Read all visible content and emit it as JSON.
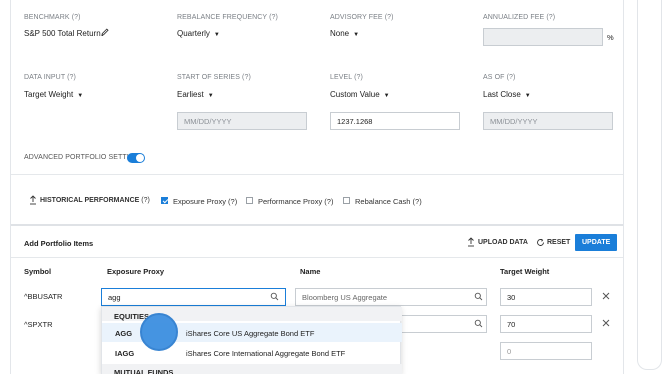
{
  "settings": {
    "benchmark": {
      "label": "BENCHMARK",
      "value": "S&P 500 Total Return"
    },
    "rebalance_frequency": {
      "label": "REBALANCE FREQUENCY",
      "value": "Quarterly"
    },
    "advisory_fee": {
      "label": "ADVISORY FEE",
      "value": "None"
    },
    "annualized_fee": {
      "label": "ANNUALIZED FEE",
      "suffix": "%"
    },
    "data_input": {
      "label": "DATA INPUT",
      "value": "Target Weight"
    },
    "start_of_series": {
      "label": "START OF SERIES",
      "value": "Earliest",
      "date_placeholder": "MM/DD/YYYY"
    },
    "level": {
      "label": "LEVEL",
      "value": "Custom Value",
      "input_value": "1237.1268"
    },
    "as_of": {
      "label": "AS OF",
      "value": "Last Close",
      "date_placeholder": "MM/DD/YYYY"
    },
    "help_mark": "(?)"
  },
  "advanced": {
    "label": "ADVANCED PORTFOLIO SETTINGS",
    "enabled": true
  },
  "options_bar": {
    "historical_performance": "HISTORICAL PERFORMANCE",
    "help_mark": "(?)",
    "exposure_proxy": {
      "label": "Exposure Proxy (?)",
      "checked": true
    },
    "performance_proxy": {
      "label": "Performance Proxy (?)",
      "checked": false
    },
    "rebalance_cash": {
      "label": "Rebalance Cash (?)",
      "checked": false
    }
  },
  "portfolio": {
    "title": "Add Portfolio Items",
    "upload_label": "UPLOAD DATA",
    "reset_label": "RESET",
    "update_label": "UPDATE",
    "columns": [
      "Symbol",
      "Exposure Proxy",
      "Name",
      "Target Weight"
    ],
    "rows": [
      {
        "symbol": "^BBUSATR",
        "proxy_value": "agg",
        "name_placeholder": "Bloomberg US Aggregate",
        "weight": "30"
      },
      {
        "symbol": "^SPXTR",
        "proxy_value": "",
        "name_placeholder": "",
        "weight": "70"
      },
      {
        "symbol": "",
        "proxy_value": "",
        "name_placeholder": "",
        "weight": "",
        "weight_placeholder": "0"
      }
    ]
  },
  "dropdown": {
    "groups": [
      {
        "header": "EQUITIES"
      },
      {
        "ticker": "AGG",
        "name": "iShares Core US Aggregate Bond ETF"
      },
      {
        "ticker": "IAGG",
        "name": "iShares Core International Aggregate Bond ETF"
      },
      {
        "header": "MUTUAL FUNDS"
      }
    ]
  },
  "colors": {
    "accent": "#1a7ed9",
    "disabled_bg": "#eceef0",
    "border": "#c8cdd2"
  }
}
